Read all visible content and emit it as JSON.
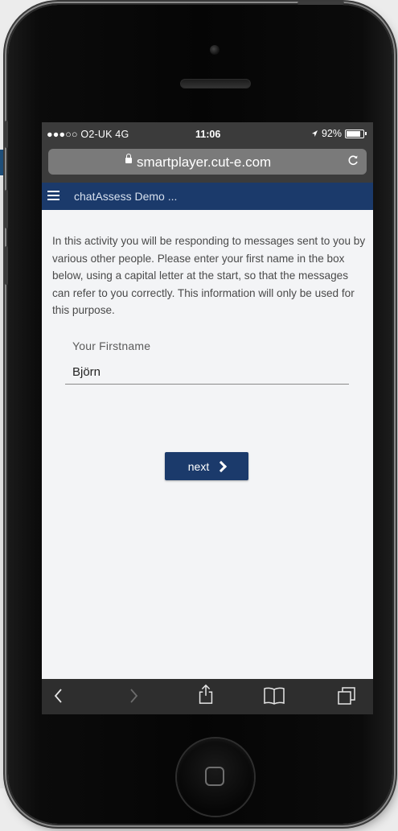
{
  "status_bar": {
    "carrier": "●●●○○ O2-UK  4G",
    "time": "11:06",
    "battery_text": "92%",
    "battery_level": 0.92
  },
  "browser": {
    "url": "smartplayer.cut-e.com",
    "reload_glyph": "C"
  },
  "app_header": {
    "title": "chatAssess Demo ..."
  },
  "content": {
    "intro": "In this activity you will be responding to messages sent to you by various other people. Please enter your first name in the box below, using a capital letter at the start, so that the messages can refer to you correctly. This information will only be used for this purpose.",
    "field_label": "Your Firstname",
    "field_value": "Björn",
    "next_label": "next"
  },
  "toolbar": {
    "back_glyph": "‹",
    "forward_glyph": "›"
  },
  "colors": {
    "header_blue": "#1b3a6b",
    "status_bar_bg": "#3b3b3b",
    "page_bg": "#f3f4f6",
    "toolbar_bg": "#2e2e2e"
  }
}
